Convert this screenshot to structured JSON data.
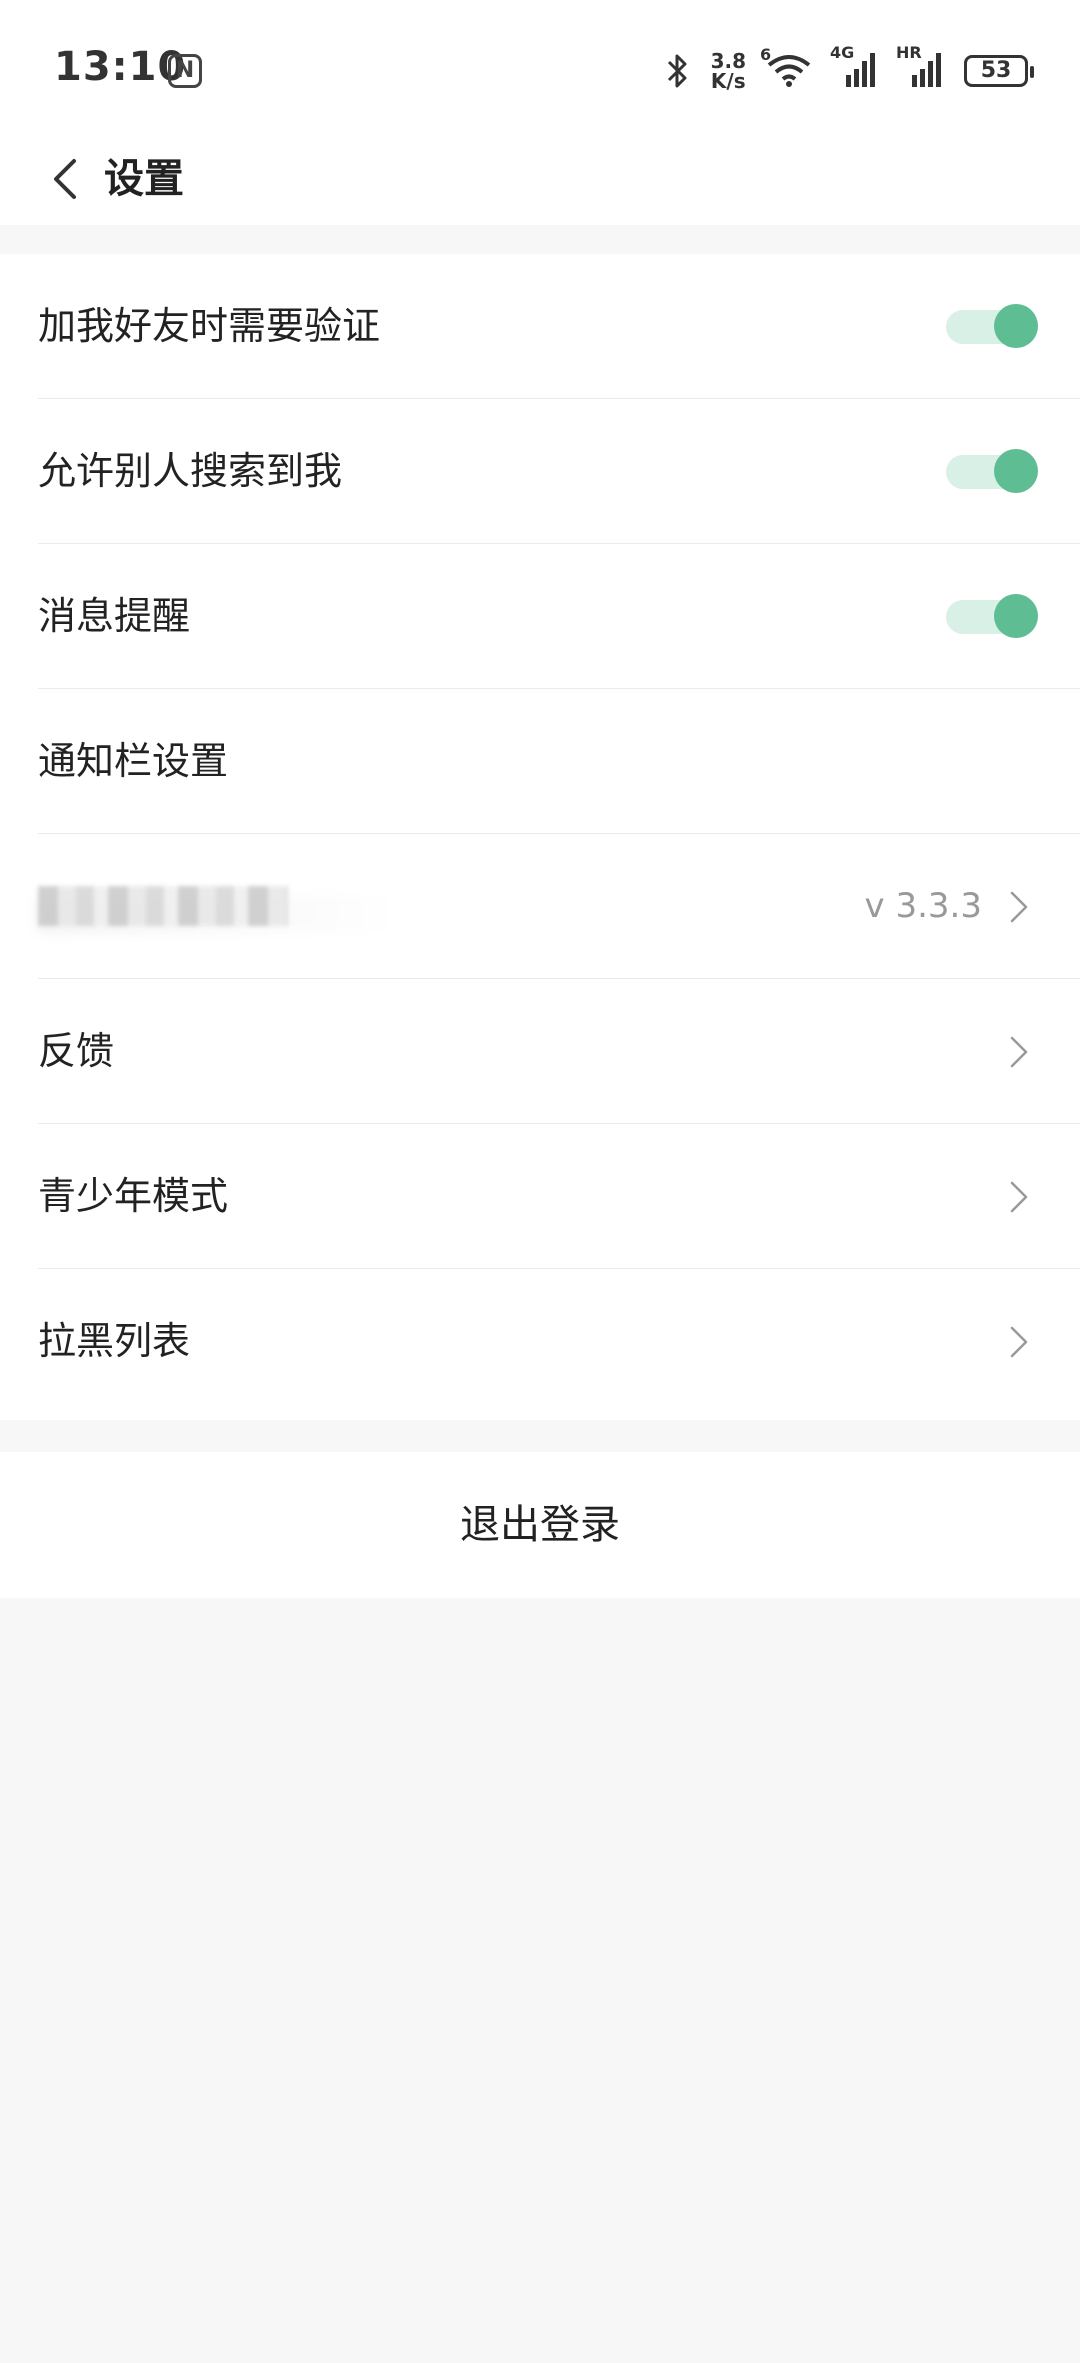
{
  "status_bar": {
    "time": "13:10",
    "nfc_label": "N",
    "net_speed_value": "3.8",
    "net_speed_unit": "K/s",
    "wifi_badge": "6",
    "sim1_label": "4G",
    "sim2_label": "HR",
    "battery": "53"
  },
  "header": {
    "title": "设置"
  },
  "settings": {
    "add_friend_verify": {
      "label": "加我好友时需要验证",
      "enabled": true
    },
    "allow_search": {
      "label": "允许别人搜索到我",
      "enabled": true
    },
    "message_alert": {
      "label": "消息提醒",
      "enabled": true
    },
    "notification_bar": {
      "label": "通知栏设置"
    },
    "about": {
      "version": "v 3.3.3"
    },
    "feedback": {
      "label": "反馈"
    },
    "teen_mode": {
      "label": "青少年模式"
    },
    "blocklist": {
      "label": "拉黑列表"
    }
  },
  "logout": {
    "label": "退出登录"
  },
  "colors": {
    "accent": "#5ebd93",
    "accent_track": "#d9f0e6",
    "background": "#f7f7f7",
    "divider": "#ebebeb"
  }
}
